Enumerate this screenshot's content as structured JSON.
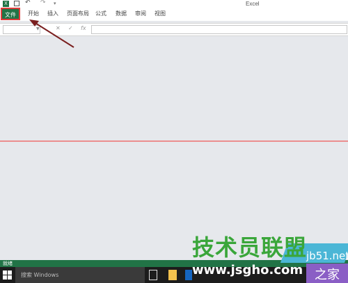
{
  "titlebar": {
    "app_title": "Excel",
    "icon_letter": "X"
  },
  "quick_access": {
    "undo_glyph": "↶",
    "redo_glyph": "↷",
    "more_glyph": "▾"
  },
  "ribbon": {
    "tabs": [
      {
        "label": "文件"
      },
      {
        "label": "开始"
      },
      {
        "label": "插入"
      },
      {
        "label": "页面布局"
      },
      {
        "label": "公式"
      },
      {
        "label": "数据"
      },
      {
        "label": "审阅"
      },
      {
        "label": "视图"
      }
    ]
  },
  "formula_bar": {
    "name_box_value": "",
    "cancel_glyph": "✕",
    "enter_glyph": "✓",
    "fx_label": "fx",
    "formula_value": ""
  },
  "status_bar": {
    "text": "就绪"
  },
  "taskbar": {
    "search_placeholder": "搜索 Windows"
  },
  "watermark": {
    "brand_cn": "技术员联盟",
    "site": "www.jsgho.com",
    "side_top": "jb51.net",
    "side_bottom": "之家"
  },
  "colors": {
    "accent": "#217346",
    "highlight_border": "#e03a3a",
    "taskbar": "#1c1c1c"
  }
}
